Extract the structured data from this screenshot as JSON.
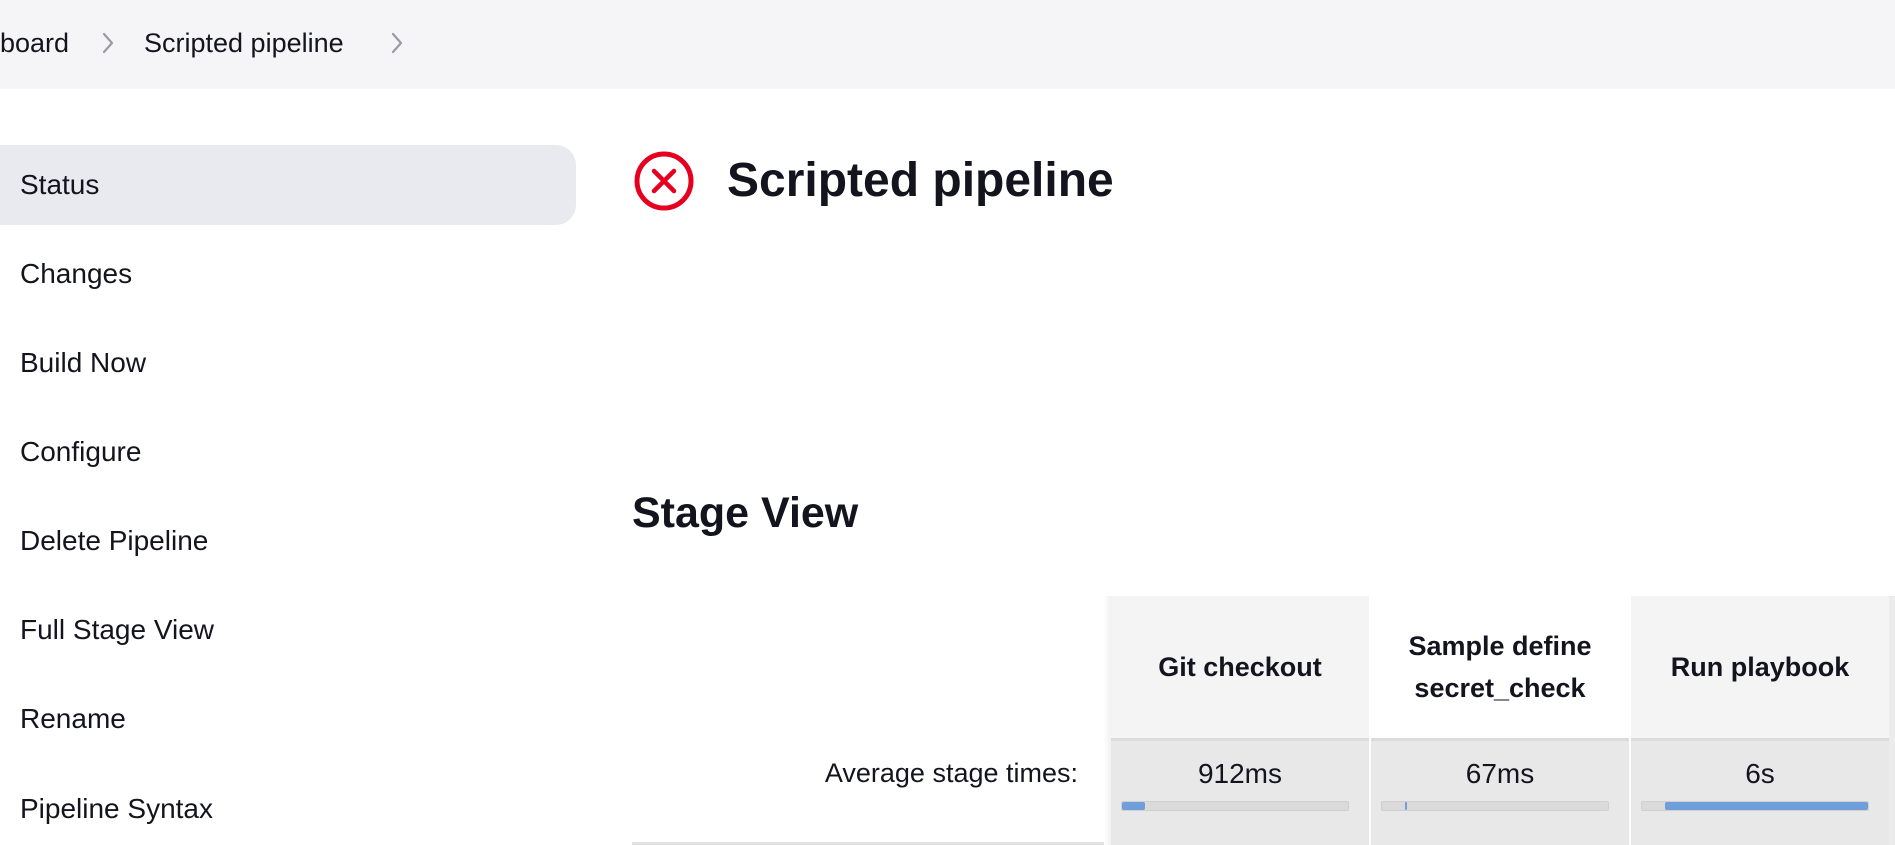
{
  "breadcrumb": {
    "items": [
      {
        "label": "board"
      },
      {
        "label": "Scripted pipeline"
      }
    ]
  },
  "sidebar": {
    "items": [
      {
        "label": "Status",
        "active": true
      },
      {
        "label": "Changes"
      },
      {
        "label": "Build Now"
      },
      {
        "label": "Configure"
      },
      {
        "label": "Delete Pipeline"
      },
      {
        "label": "Full Stage View"
      },
      {
        "label": "Rename"
      },
      {
        "label": "Pipeline Syntax"
      }
    ]
  },
  "header": {
    "title": "Scripted pipeline",
    "status_icon": "failed-x-circle-icon",
    "status_color": "#e6001f"
  },
  "stage_view": {
    "title": "Stage View",
    "average_label": "Average stage times:",
    "progress_color": "#6f9fdb",
    "stages": [
      {
        "name": "Git checkout",
        "avg_time": "912ms",
        "bar_start": 0.0,
        "bar_fill": 0.1
      },
      {
        "name": "Sample define secret_check",
        "avg_time": "67ms",
        "bar_start": 0.1,
        "bar_fill": 0.01
      },
      {
        "name": "Run playbook",
        "avg_time": "6s",
        "bar_start": 0.1,
        "bar_fill": 0.9
      }
    ]
  }
}
